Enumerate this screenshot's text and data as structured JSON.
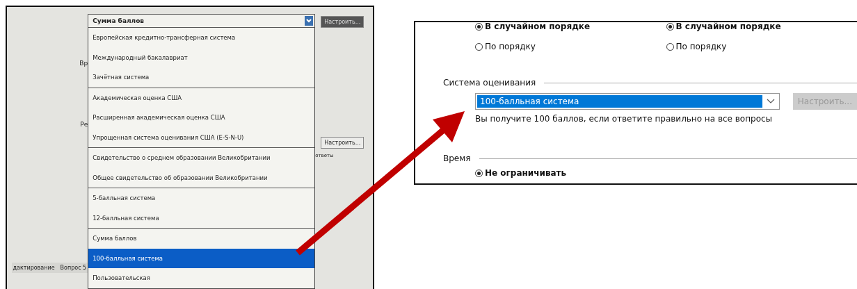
{
  "photo_screen": {
    "combo": {
      "value": "Сумма баллов"
    },
    "configure_button": {
      "label": "Настроить..."
    },
    "side_labels": [
      "Вр",
      "Ре"
    ],
    "list_groups": [
      [
        {
          "label": "Европейская кредитно-трансферная система",
          "selected": false
        },
        {
          "label": "Международный бакалавриат",
          "selected": false
        },
        {
          "label": "Зачётная система",
          "selected": false
        }
      ],
      [
        {
          "label": "Академическая оценка США",
          "selected": false
        },
        {
          "label": "Расширенная академическая оценка США",
          "selected": false
        },
        {
          "label": "Упрощенная система оценивания США (E-S-N-U)",
          "selected": false
        }
      ],
      [
        {
          "label": "Свидетельство о среднем образовании Великобритании",
          "selected": false
        },
        {
          "label": "Общее свидетельство об образовании Великобритании",
          "selected": false
        }
      ],
      [
        {
          "label": "5-балльная система",
          "selected": false
        },
        {
          "label": "12-балльная система",
          "selected": false
        }
      ],
      [
        {
          "label": "Сумма баллов",
          "selected": false
        },
        {
          "label": "100-балльная система",
          "selected": true
        },
        {
          "label": "Пользовательская",
          "selected": false
        }
      ]
    ],
    "second_button": {
      "label": "Настроить..."
    },
    "answers_label": "ответы",
    "bottom_tabs": [
      "дактирование",
      "Вопрос 5"
    ]
  },
  "screenshot": {
    "order_columns": [
      [
        {
          "label": "В случайном порядке",
          "selected": true
        },
        {
          "label": "По порядку",
          "selected": false
        }
      ],
      [
        {
          "label": "В случайном порядке",
          "selected": true
        },
        {
          "label": "По порядку",
          "selected": false
        }
      ]
    ],
    "grading": {
      "title": "Система оценивания",
      "select": {
        "value": "100-балльная система"
      },
      "button": {
        "label": "Настроить...",
        "disabled": true
      },
      "hint": "Вы получите 100 баллов, если ответите правильно на все вопросы"
    },
    "time": {
      "title": "Время",
      "options": [
        {
          "label": "Не ограничивать",
          "selected": true
        }
      ]
    }
  }
}
